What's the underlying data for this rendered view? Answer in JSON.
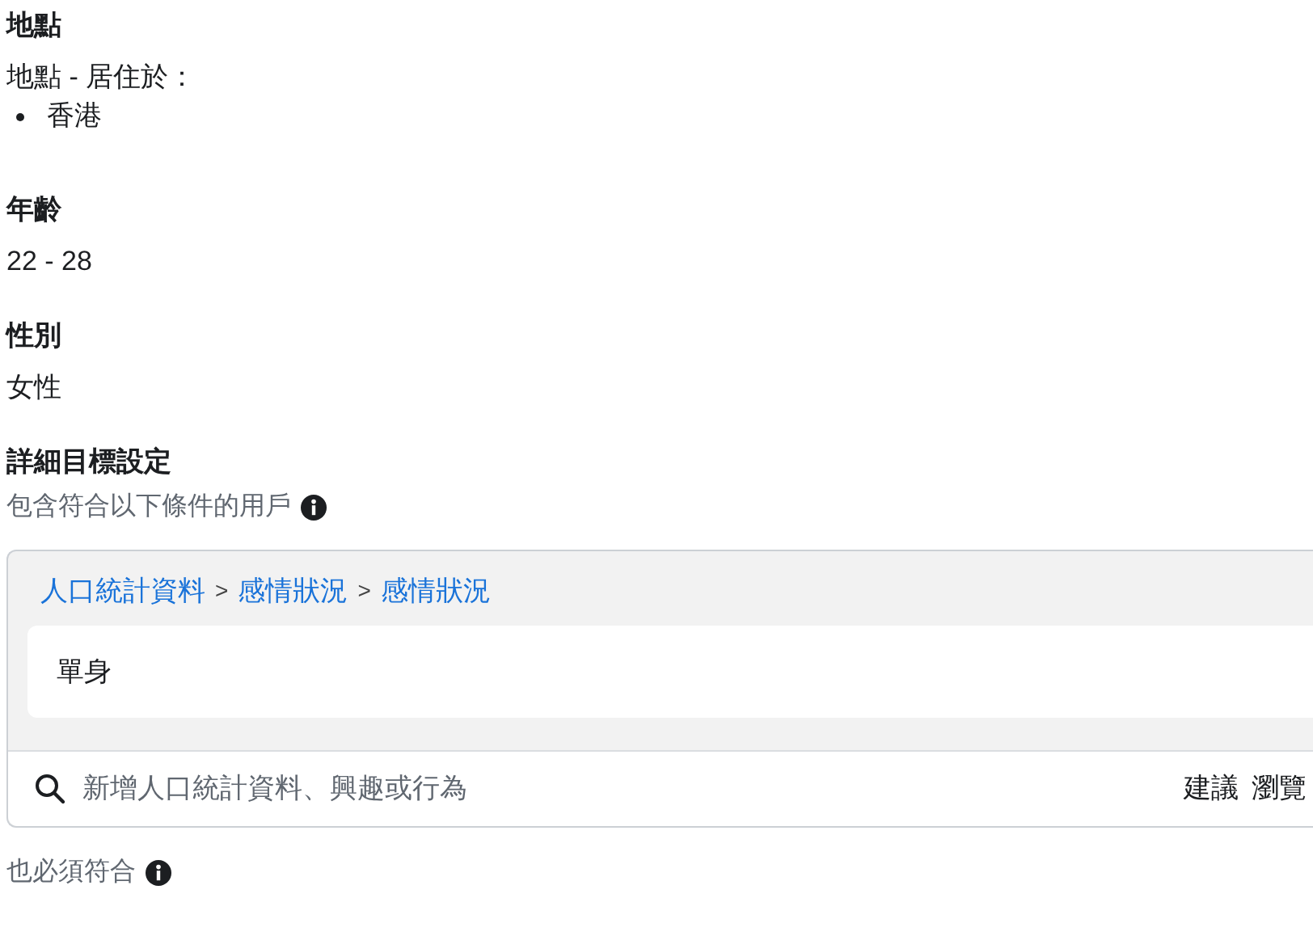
{
  "sections": [
    {
      "kind": "list",
      "title": "地點",
      "label": "地點 - 居住於：",
      "items": [
        "香港"
      ]
    },
    {
      "kind": "value",
      "title": "年齡",
      "value": "22 - 28"
    },
    {
      "kind": "value",
      "title": "性別",
      "value": "女性"
    }
  ],
  "detailed_targeting": {
    "title": "詳細目標設定",
    "include_label": "包含符合以下條件的用戶",
    "breadcrumb": [
      {
        "kind": "link",
        "text": "人口統計資料"
      },
      {
        "kind": "separator",
        "text": ">"
      },
      {
        "kind": "link",
        "text": "感情狀況"
      },
      {
        "kind": "separator",
        "text": ">"
      },
      {
        "kind": "link",
        "text": "感情狀況"
      }
    ],
    "selected_items": [
      "單身"
    ],
    "search": {
      "placeholder": "新增人口統計資料、興趣或行為"
    },
    "actions": [
      "建議",
      "瀏覽"
    ],
    "also_label": "也必須符合"
  }
}
